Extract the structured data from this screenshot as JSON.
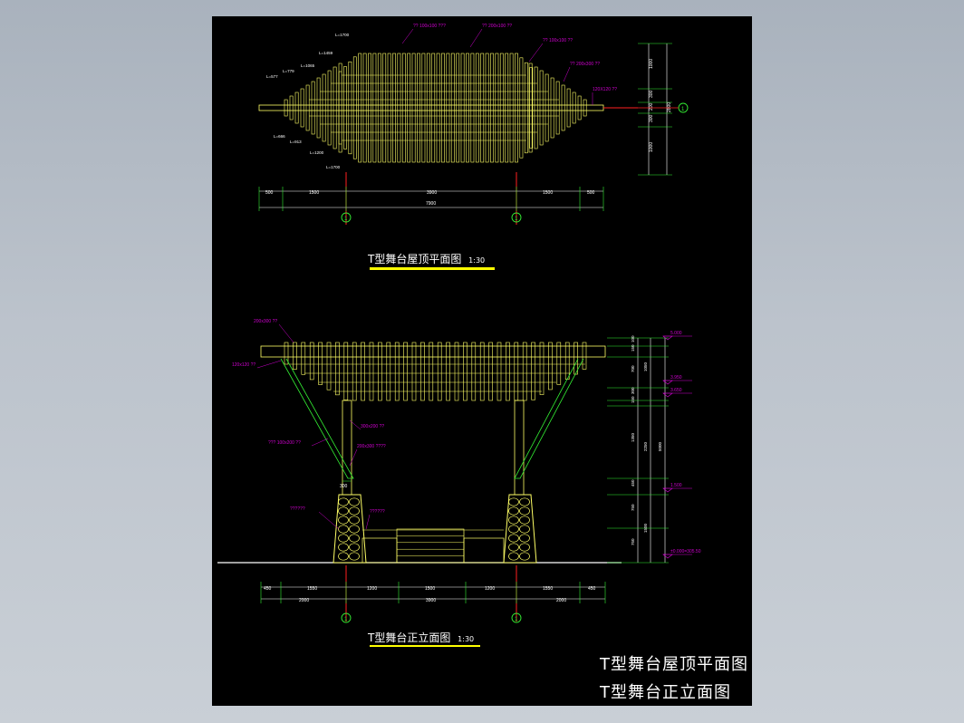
{
  "colors": {
    "background": "#000000",
    "window_bg": "#b7bec7",
    "structure": "#ffff66",
    "green": "#33ee33",
    "magenta": "#d000d0",
    "white": "#ffffff",
    "red": "#ff2020",
    "yellow_underline": "#ffff00"
  },
  "plan": {
    "title": "T型舞台屋顶平面图",
    "scale": "1:30",
    "top_labels": [
      "?? 100x100 ???",
      "?? 200x100 ??",
      "?? 100x100 ??",
      "?? 200x300 ??",
      "120X120 ??"
    ],
    "left_lengths": [
      "L=1700",
      "L=1459",
      "L=1065",
      "L=779",
      "L=577",
      "L=666",
      "L=913",
      "L=1200",
      "L=1700"
    ],
    "dims_bottom": [
      "500",
      "1500",
      "3900",
      "1500",
      "500"
    ],
    "dim_total": "7900",
    "dims_right": [
      "1000",
      "300",
      "200",
      "300",
      "1000",
      "2800"
    ],
    "axis_left": "1",
    "axis_right": "1",
    "axis_side": "1"
  },
  "elevation": {
    "title": "T型舞台正立面图",
    "scale": "1:30",
    "labels": [
      "200x300 ??",
      "120x120 ??",
      "300x200 ??",
      "200x300 ????",
      "??? 100x200 ??",
      "??????",
      "??????"
    ],
    "column_label": "300",
    "levels": [
      "5.000",
      "3.950",
      "3.650",
      "1.500",
      "±0.000=305.50"
    ],
    "dims_right_inner": [
      "100",
      "150",
      "700",
      "300",
      "150",
      "1350",
      "450",
      "750",
      "750"
    ],
    "dims_right_outer": [
      "1050",
      "2250",
      "1500"
    ],
    "dim_total_right": "5000",
    "dims_bottom": [
      "450",
      "1550",
      "1200",
      "1500",
      "1200",
      "1550",
      "450"
    ],
    "dims_bottom2": [
      "2000",
      "3900",
      "2000"
    ]
  },
  "sheet_titles": [
    "T型舞台屋顶平面图",
    "T型舞台正立面图"
  ]
}
